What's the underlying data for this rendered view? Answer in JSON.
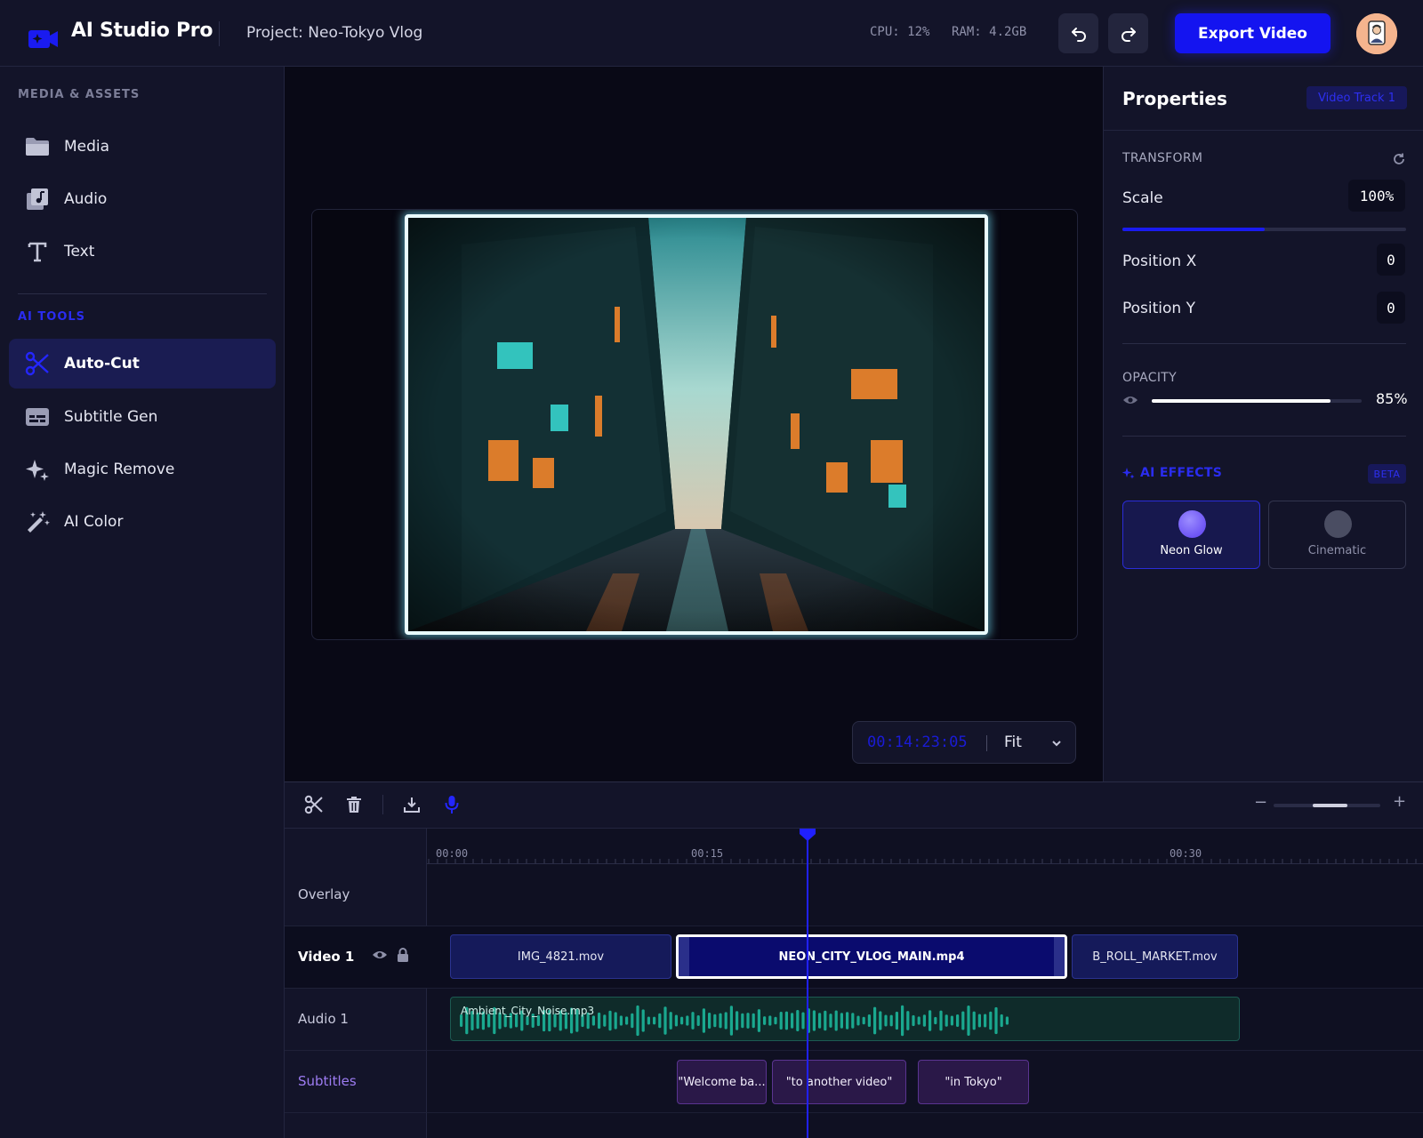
{
  "header": {
    "app_title": "AI Studio Pro",
    "project": "Project: Neo-Tokyo Vlog",
    "cpu": "CPU: 12%",
    "ram": "RAM: 4.2GB",
    "export_label": "Export Video",
    "icons": {
      "logo": "video-camera-icon",
      "undo": "undo-icon",
      "redo": "redo-icon",
      "avatar": "user-avatar"
    }
  },
  "sidebar": {
    "media_section": "MEDIA & ASSETS",
    "media_items": [
      {
        "label": "Media",
        "icon": "folder-icon"
      },
      {
        "label": "Audio",
        "icon": "music-library-icon"
      },
      {
        "label": "Text",
        "icon": "text-icon"
      }
    ],
    "ai_section": "AI TOOLS",
    "ai_items": [
      {
        "label": "Auto-Cut",
        "icon": "scissors-icon",
        "active": true
      },
      {
        "label": "Subtitle Gen",
        "icon": "subtitles-icon",
        "active": false
      },
      {
        "label": "Magic Remove",
        "icon": "sparkle-icon",
        "active": false
      },
      {
        "label": "AI Color",
        "icon": "magic-wand-icon",
        "active": false
      }
    ]
  },
  "preview": {
    "timecode": "00:14:23:05",
    "zoom": "Fit"
  },
  "properties": {
    "title": "Properties",
    "track_badge": "Video Track 1",
    "transform_label": "TRANSFORM",
    "scale_label": "Scale",
    "scale_value": "100%",
    "scale_slider_fraction": 0.5,
    "position_x_label": "Position X",
    "position_x_value": "0",
    "position_y_label": "Position Y",
    "position_y_value": "0",
    "opacity_label": "OPACITY",
    "opacity_value": "85%",
    "opacity_fraction": 0.85,
    "ai_effects_label": "AI EFFECTS",
    "beta_badge": "BETA",
    "effects": [
      {
        "label": "Neon Glow",
        "selected": true
      },
      {
        "label": "Cinematic",
        "selected": false
      }
    ]
  },
  "timeline": {
    "zoom_fraction": 0.45,
    "ruler": [
      "00:00",
      "00:15",
      "00:30"
    ],
    "tracks": [
      {
        "name": "Overlay"
      },
      {
        "name": "Video 1"
      },
      {
        "name": "Audio 1"
      },
      {
        "name": "Subtitles"
      }
    ],
    "video_clips": [
      "IMG_4821.mov",
      "NEON_CITY_VLOG_MAIN.mp4",
      "B_ROLL_MARKET.mov"
    ],
    "audio_clip": "Ambient_City_Noise.mp3",
    "subtitle_clips": [
      "\"Welcome ba...",
      "\"to another video\"",
      "\"in Tokyo\""
    ]
  },
  "colors": {
    "accent": "#1414f0",
    "background": "#0f1022",
    "panel": "#131429",
    "neon_frame": "#e9fbff",
    "audio_wave": "#1aa88f",
    "subtitle_clip": "#2a1848"
  }
}
